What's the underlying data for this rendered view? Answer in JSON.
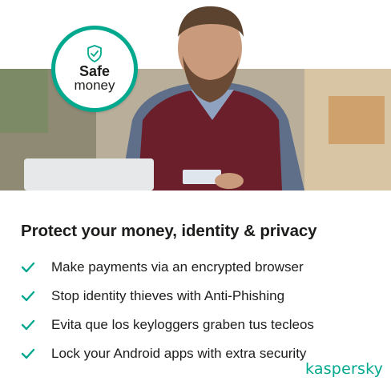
{
  "badge": {
    "line1": "Safe",
    "line2": "money",
    "icon": "shield-check-icon"
  },
  "headline": "Protect your money, identity & privacy",
  "features": [
    {
      "text": "Make payments via an encrypted browser",
      "icon": "check-icon"
    },
    {
      "text": "Stop identity thieves with Anti-Phishing",
      "icon": "check-icon"
    },
    {
      "text": "Evita que los keyloggers graben tus tecleos",
      "icon": "check-icon"
    },
    {
      "text": "Lock your Android apps with extra security",
      "icon": "check-icon"
    }
  ],
  "brand": "kaspersky",
  "colors": {
    "accent": "#00a88e",
    "text": "#1d1d1b"
  }
}
